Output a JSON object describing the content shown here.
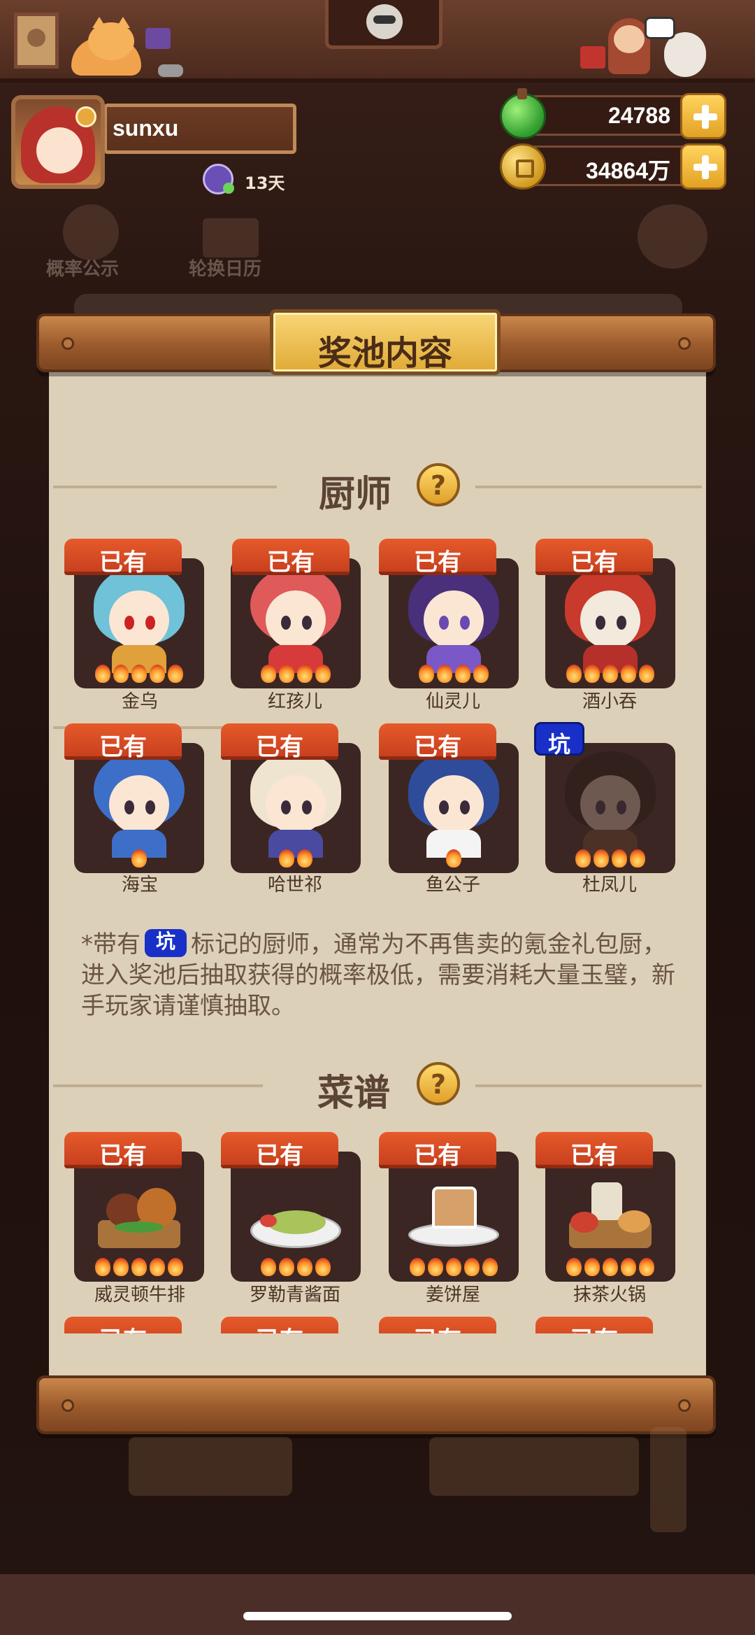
{
  "player": {
    "name": "sunxu",
    "days": "13天"
  },
  "currencies": [
    {
      "name": "jade",
      "value": "24788"
    },
    {
      "name": "coins",
      "value": "34864万"
    }
  ],
  "background_buttons": {
    "rates": "概率公示",
    "calendar": "轮换日历"
  },
  "modal": {
    "title": "奖池内容",
    "chefs_section": "厨师",
    "recipes_section": "菜谱",
    "help_icon": "?",
    "owned_label": "已有",
    "pit_label": "坑",
    "note_prefix": "*带有",
    "note_body": "标记的厨师，通常为不再售卖的氪金礼包厨，进入奖池后抽取获得的概率极低，需要消耗大量玉璧，新手玩家请谨慎抽取。",
    "chefs": [
      {
        "name": "金乌",
        "owned": "已有",
        "stars": 5
      },
      {
        "name": "红孩儿",
        "owned": "已有",
        "stars": 4
      },
      {
        "name": "仙灵儿",
        "owned": "已有",
        "stars": 4
      },
      {
        "name": "酒小吞",
        "owned": "已有",
        "stars": 5
      },
      {
        "name": "海宝",
        "owned": "已有",
        "stars": 1
      },
      {
        "name": "哈世祁",
        "owned": "已有",
        "stars": 2
      },
      {
        "name": "鱼公子",
        "owned": "已有",
        "stars": 1
      },
      {
        "name": "杜凤儿",
        "owned": "",
        "pit": "坑",
        "stars": 4
      }
    ],
    "recipes": [
      {
        "name": "威灵顿牛排",
        "owned": "已有",
        "stars": 5
      },
      {
        "name": "罗勒青酱面",
        "owned": "已有",
        "stars": 4
      },
      {
        "name": "姜饼屋",
        "owned": "已有",
        "stars": 5
      },
      {
        "name": "抹茶火锅",
        "owned": "已有",
        "stars": 5
      }
    ]
  },
  "colors": {
    "owned_tag": "#d84a22",
    "pit_tag": "#1830c8",
    "parchment": "#ddd0b8",
    "plaque": "#f0c150"
  }
}
